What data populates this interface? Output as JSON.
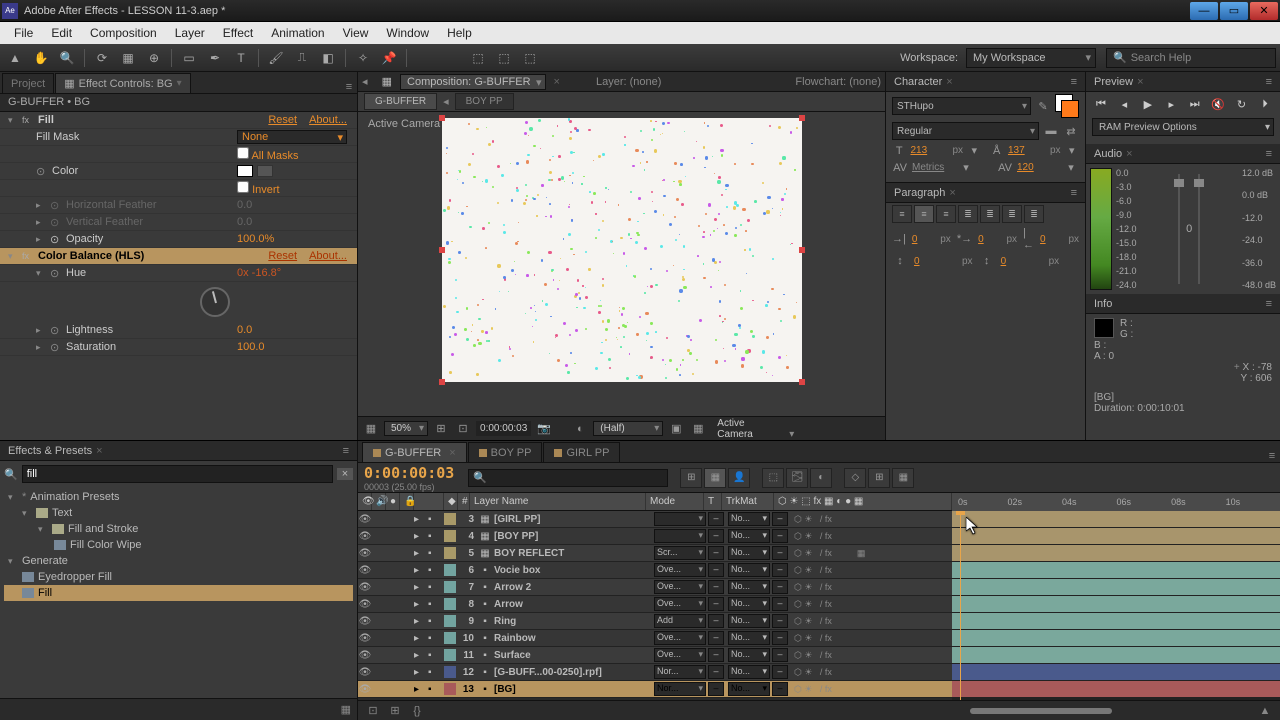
{
  "titlebar": {
    "app": "Adobe After Effects",
    "file": "LESSON 11-3.aep *"
  },
  "menu": [
    "File",
    "Edit",
    "Composition",
    "Layer",
    "Effect",
    "Animation",
    "View",
    "Window",
    "Help"
  ],
  "workspace": {
    "label": "Workspace:",
    "value": "My Workspace"
  },
  "search_help": "Search Help",
  "left_tabs": {
    "project": "Project",
    "ec": "Effect Controls: BG"
  },
  "ec_header": "G-BUFFER • BG",
  "effects": {
    "fill": {
      "name": "Fill",
      "reset": "Reset",
      "about": "About...",
      "mask_label": "Fill Mask",
      "mask_value": "None",
      "allmasks": "All Masks",
      "color": "Color",
      "invert": "Invert",
      "hfeather": "Horizontal Feather",
      "vfeather": "Vertical Feather",
      "feather_val": "0.0",
      "opacity": "Opacity",
      "opacity_val": "100.0%"
    },
    "cb": {
      "name": "Color Balance (HLS)",
      "reset": "Reset",
      "about": "About...",
      "hue": "Hue",
      "hue_val": "0x -16.8°",
      "lightness": "Lightness",
      "lightness_val": "0.0",
      "saturation": "Saturation",
      "saturation_val": "100.0"
    }
  },
  "comp": {
    "dd_prefix": "Composition:",
    "dd_value": "G-BUFFER",
    "layer_label": "Layer: (none)",
    "flow_label": "Flowchart: (none)",
    "subtabs": [
      "G-BUFFER",
      "BOY PP"
    ],
    "active_camera": "Active Camera"
  },
  "viewerbar": {
    "zoom": "50%",
    "timecode": "0:00:00:03",
    "res": "(Half)",
    "cam": "Active Camera"
  },
  "character": {
    "title": "Character",
    "font": "STHupo",
    "style": "Regular",
    "size": "213",
    "leading": "137",
    "kerning": "Metrics",
    "tracking": "120",
    "unit": "px"
  },
  "paragraph": {
    "title": "Paragraph",
    "indent_l": "0",
    "indent_r": "0",
    "indent_f": "0",
    "space_b": "0",
    "space_a": "0",
    "unit": "px"
  },
  "preview": {
    "title": "Preview",
    "ram": "RAM Preview Options"
  },
  "audio": {
    "title": "Audio",
    "left_labels": [
      "0.0",
      "-3.0",
      "-6.0",
      "-9.0",
      "-12.0",
      "-15.0",
      "-18.0",
      "-21.0",
      "-24.0"
    ],
    "right_labels": [
      "12.0 dB",
      "0.0 dB",
      "-12.0",
      "-24.0",
      "-36.0",
      "-48.0 dB"
    ],
    "slider_l": "0",
    "slider_r": "0"
  },
  "info": {
    "title": "Info",
    "r": "R :",
    "g": "G :",
    "b": "B :",
    "a": "A : 0",
    "x": "X : -78",
    "y": "Y : 606",
    "bg": "[BG]",
    "dur": "Duration: 0:00:10:01"
  },
  "ep": {
    "title": "Effects & Presets",
    "query": "fill",
    "tree": {
      "presets": "Animation Presets",
      "text": "Text",
      "fns": "Fill and Stroke",
      "wipe": "Fill Color Wipe",
      "generate": "Generate",
      "eyedrop": "Eyedropper Fill",
      "fill_fx": "Fill"
    }
  },
  "timeline": {
    "tabs": [
      "G-BUFFER",
      "BOY PP",
      "GIRL PP"
    ],
    "tc": "0:00:00:03",
    "frame_info": "00003 (25.00 fps)",
    "cols": {
      "num": "#",
      "layer": "Layer Name",
      "mode": "Mode",
      "t": "T",
      "trkmat": "TrkMat"
    },
    "ruler": [
      "0s",
      "02s",
      "04s",
      "06s",
      "08s",
      "10s"
    ],
    "layers": [
      {
        "n": 3,
        "name": "[GIRL PP]",
        "mode": "",
        "trk": "No...",
        "color": "#a89968",
        "type": "comp",
        "bar": "tan"
      },
      {
        "n": 4,
        "name": "[BOY PP]",
        "mode": "",
        "trk": "No...",
        "color": "#a89968",
        "type": "comp",
        "bar": "tan"
      },
      {
        "n": 5,
        "name": "BOY REFLECT",
        "mode": "Scr...",
        "trk": "No...",
        "color": "#a89968",
        "type": "comp",
        "bar": "tan",
        "cube": true
      },
      {
        "n": 6,
        "name": "Vocie box",
        "mode": "Ove...",
        "trk": "No...",
        "color": "#72a4a0",
        "type": "solid",
        "bar": "teal"
      },
      {
        "n": 7,
        "name": "Arrow 2",
        "mode": "Ove...",
        "trk": "No...",
        "color": "#72a4a0",
        "type": "solid",
        "bar": "teal"
      },
      {
        "n": 8,
        "name": "Arrow",
        "mode": "Ove...",
        "trk": "No...",
        "color": "#72a4a0",
        "type": "solid",
        "bar": "teal"
      },
      {
        "n": 9,
        "name": "Ring",
        "mode": "Add",
        "trk": "No...",
        "color": "#72a4a0",
        "type": "solid",
        "bar": "teal"
      },
      {
        "n": 10,
        "name": "Rainbow",
        "mode": "Ove...",
        "trk": "No...",
        "color": "#72a4a0",
        "type": "solid",
        "bar": "teal"
      },
      {
        "n": 11,
        "name": "Surface",
        "mode": "Ove...",
        "trk": "No...",
        "color": "#72a4a0",
        "type": "solid",
        "bar": "teal"
      },
      {
        "n": 12,
        "name": "[G-BUFF...00-0250].rpf]",
        "mode": "Nor...",
        "trk": "No...",
        "color": "#4a5a8c",
        "type": "footage",
        "bar": "blue"
      },
      {
        "n": 13,
        "name": "[BG]",
        "mode": "Nor...",
        "trk": "No...",
        "color": "#a85a5a",
        "type": "solid",
        "bar": "red",
        "sel": true
      }
    ]
  }
}
